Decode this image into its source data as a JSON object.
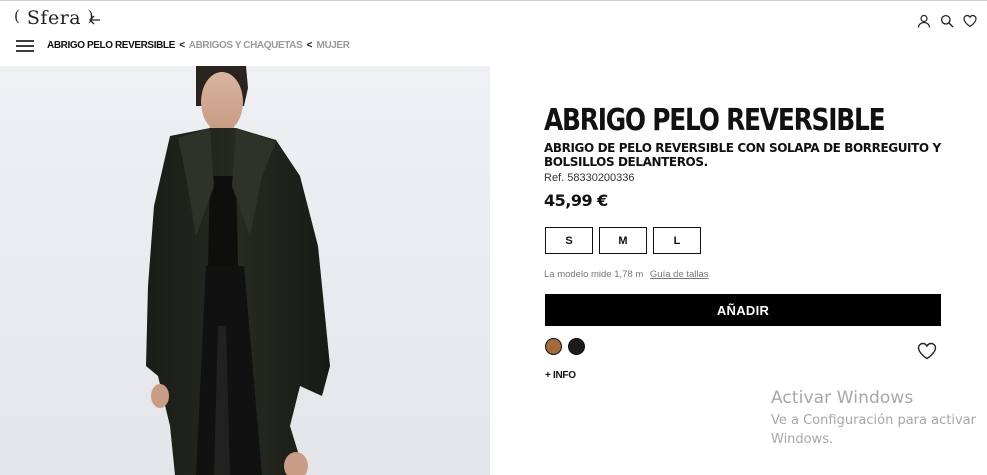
{
  "header": {
    "logo": "Sfera",
    "logo_paren_open": "(",
    "logo_paren_close": ")",
    "icons": [
      "back-arrow-icon",
      "user-icon",
      "search-icon",
      "heart-icon"
    ]
  },
  "breadcrumb": {
    "current": "ABRIGO PELO REVERSIBLE",
    "separator": "<",
    "items": [
      "ABRIGOS Y CHAQUETAS",
      "MUJER"
    ]
  },
  "product": {
    "title": "ABRIGO PELO REVERSIBLE",
    "description": "ABRIGO DE PELO REVERSIBLE CON SOLAPA DE BORREGUITO Y BOLSILLOS DELANTEROS.",
    "ref": "Ref. 58330200336",
    "price": "45,99 €",
    "sizes": [
      "S",
      "M",
      "L"
    ],
    "model_info": "La modelo mide 1,78 m",
    "size_guide": "Guía de tallas",
    "add_label": "AÑADIR",
    "colors": [
      "#a36a3c",
      "#1b1b1b"
    ],
    "more_info": "+ INFO"
  },
  "watermark": {
    "title": "Activar Windows",
    "line1": "Ve a Configuración para activar",
    "line2": "Windows."
  }
}
